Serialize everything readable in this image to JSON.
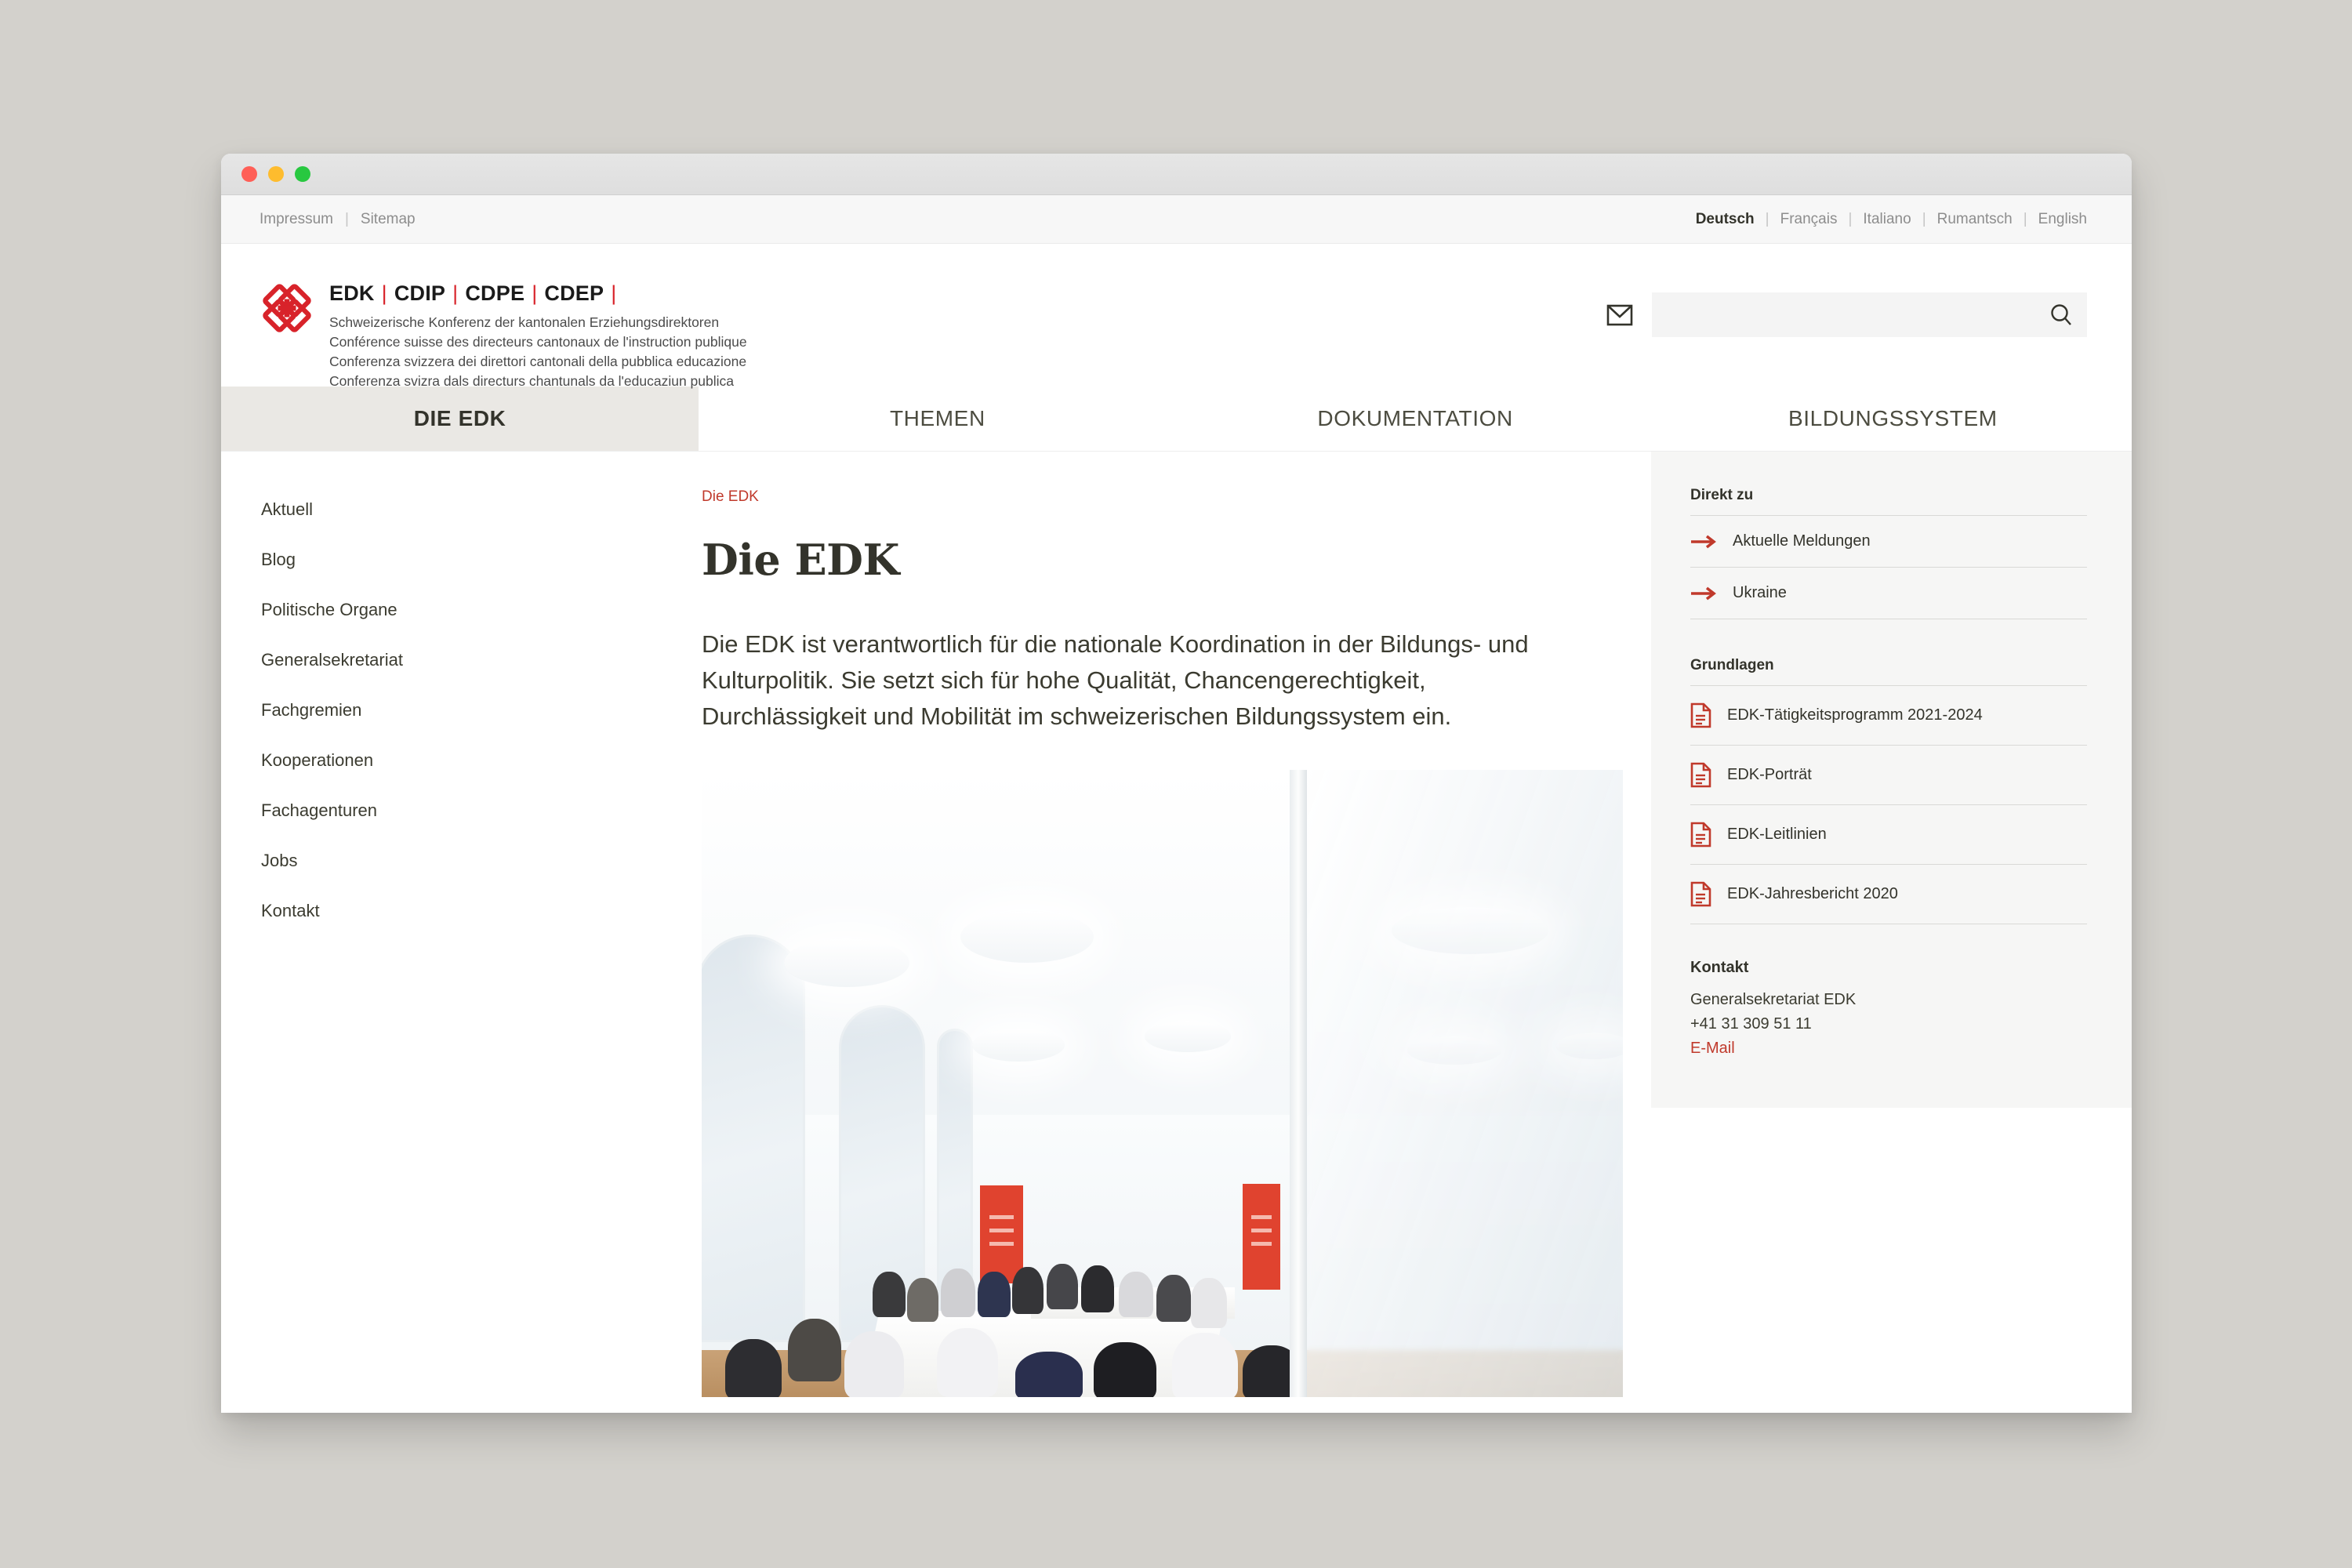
{
  "window": {
    "traffic_lights": [
      "close",
      "minimize",
      "maximize"
    ]
  },
  "utility_bar": {
    "left_links": [
      "Impressum",
      "Sitemap"
    ],
    "separator": "|",
    "languages": [
      {
        "label": "Deutsch",
        "active": true
      },
      {
        "label": "Français",
        "active": false
      },
      {
        "label": "Italiano",
        "active": false
      },
      {
        "label": "Rumantsch",
        "active": false
      },
      {
        "label": "English",
        "active": false
      }
    ]
  },
  "brand": {
    "logo_icon": "edk-knot-logo",
    "acronyms": [
      "EDK",
      "CDIP",
      "CDPE",
      "CDEP"
    ],
    "divider": "|",
    "subtitles": [
      "Schweizerische Konferenz der kantonalen Erziehungsdirektoren",
      "Conférence suisse des directeurs cantonaux de l'instruction publique",
      "Conferenza svizzera dei direttori cantonali della pubblica educazione",
      "Conferenza svizra dals directurs chantunals da l'educaziun publica"
    ]
  },
  "search": {
    "mail_icon": "envelope-icon",
    "search_icon": "search-icon",
    "value": "",
    "placeholder": ""
  },
  "main_nav": [
    {
      "label": "DIE EDK",
      "active": true
    },
    {
      "label": "THEMEN",
      "active": false
    },
    {
      "label": "DOKUMENTATION",
      "active": false
    },
    {
      "label": "BILDUNGSSYSTEM",
      "active": false
    }
  ],
  "sidebar": {
    "items": [
      {
        "label": "Aktuell"
      },
      {
        "label": "Blog"
      },
      {
        "label": "Politische Organe"
      },
      {
        "label": "Generalsekretariat"
      },
      {
        "label": "Fachgremien"
      },
      {
        "label": "Kooperationen"
      },
      {
        "label": "Fachagenturen"
      },
      {
        "label": "Jobs"
      },
      {
        "label": "Kontakt"
      }
    ]
  },
  "main": {
    "breadcrumb": "Die EDK",
    "title": "Die EDK",
    "lead": "Die EDK ist verantwortlich für die nationale Koordination in der Bildungs- und Kulturpolitik. Sie setzt sich für hohe Qualität, Chancengerechtigkeit, Durchlässigkeit und Mobilität im schweizerischen Bildungssystem ein.",
    "photo_alt": "Sitzung der EDK Plenarversammlung in einem hellen Konferenzraum"
  },
  "right_sidebar": {
    "direkt_zu": {
      "heading": "Direkt zu",
      "links": [
        {
          "label": "Aktuelle Meldungen",
          "icon": "arrow-right-icon"
        },
        {
          "label": "Ukraine",
          "icon": "arrow-right-icon"
        }
      ]
    },
    "grundlagen": {
      "heading": "Grundlagen",
      "documents": [
        {
          "label": "EDK-Tätigkeitsprogramm 2021-2024",
          "icon": "document-icon"
        },
        {
          "label": "EDK-Porträt",
          "icon": "document-icon"
        },
        {
          "label": "EDK-Leitlinien",
          "icon": "document-icon"
        },
        {
          "label": "EDK-Jahresbericht 2020",
          "icon": "document-icon"
        }
      ]
    },
    "kontakt": {
      "heading": "Kontakt",
      "org": "Generalsekretariat EDK",
      "phone": "+41 31 309 51 11",
      "email_label": "E-Mail"
    }
  },
  "colors": {
    "brand_red": "#d8232a",
    "link_red": "#c0392b",
    "text_dark": "#33332b",
    "active_tab_bg": "#eae8e4",
    "sidebar_bg": "#f6f6f5",
    "desktop_bg": "#d3d1cc"
  }
}
